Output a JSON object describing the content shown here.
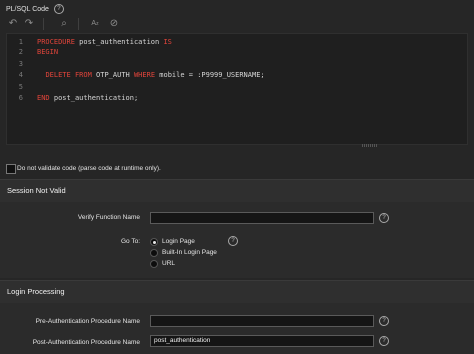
{
  "section": {
    "title": "PL/SQL Code"
  },
  "toolbar": {
    "undo_icon": "undo-icon",
    "redo_icon": "redo-icon",
    "search_icon": "search-icon",
    "autocomplete_icon": "autocomplete-icon",
    "validate_icon": "check-circle-icon"
  },
  "editor": {
    "line_numbers": [
      "1",
      "2",
      "3",
      "4",
      "5",
      "6"
    ],
    "lines": [
      {
        "kw1": "PROCEDURE",
        "text": " post_authentication ",
        "kw2": "IS"
      },
      {
        "kw1": "BEGIN",
        "text": "",
        "kw2": ""
      },
      {
        "kw1": "",
        "text": "",
        "kw2": ""
      },
      {
        "kw1": "",
        "text": ""
      },
      {
        "kw1": "",
        "text": "",
        "kw2": ""
      },
      {
        "kw1": "END",
        "text": " post_authentication;",
        "kw2": ""
      }
    ],
    "line4": {
      "indent": "  ",
      "delete": "DELETE",
      "from": "FROM",
      "table": " OTP_AUTH ",
      "where": "WHERE",
      "rest": " mobile = :P9999_USERNAME;"
    }
  },
  "validate_checkbox": {
    "label": "Do not validate code (parse code at runtime only)."
  },
  "session_not_valid": {
    "title": "Session Not Valid",
    "verify_label": "Verify Function Name",
    "verify_value": "",
    "goto_label": "Go To:",
    "options": [
      "Login Page",
      "Built-In Login Page",
      "URL"
    ],
    "selected": "Login Page"
  },
  "login_processing": {
    "title": "Login Processing",
    "pre_label": "Pre-Authentication Procedure Name",
    "pre_value": "",
    "post_label": "Post-Authentication Procedure Name",
    "post_value": "post_authentication"
  },
  "colors": {
    "keyword": "#e0443a",
    "background": "#262626",
    "editor_bg": "#1f1f1f"
  }
}
